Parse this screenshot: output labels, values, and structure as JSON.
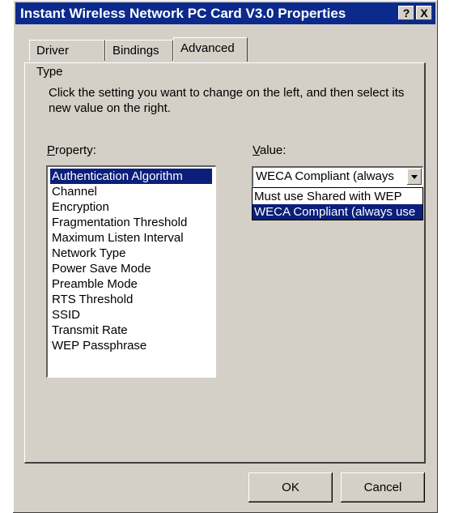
{
  "window": {
    "title": "Instant Wireless Network PC Card V3.0 Properties",
    "help_glyph": "?",
    "close_glyph": "X"
  },
  "tabs": [
    {
      "label": "Driver Type",
      "active": false
    },
    {
      "label": "Bindings",
      "active": false
    },
    {
      "label": "Advanced",
      "active": true
    }
  ],
  "advanced": {
    "instructions": "Click the setting you want to change on the left, and then select its new value on the right.",
    "property_label": {
      "accel": "P",
      "rest": "roperty:"
    },
    "value_label": {
      "accel": "V",
      "rest": "alue:"
    },
    "properties": [
      "Authentication Algorithm",
      "Channel",
      "Encryption",
      "Fragmentation Threshold",
      "Maximum Listen Interval",
      "Network Type",
      "Power Save Mode",
      "Preamble Mode",
      "RTS Threshold",
      "SSID",
      "Transmit Rate",
      "WEP Passphrase"
    ],
    "selected_property": "Authentication Algorithm",
    "value": {
      "current": "WECA Compliant (always",
      "options": [
        "Must use Shared with WEP",
        "WECA Compliant (always use"
      ],
      "highlighted_option": "WECA Compliant (always use"
    }
  },
  "buttons": {
    "ok": "OK",
    "cancel": "Cancel"
  },
  "colors": {
    "titlebar": "#0c2a8c",
    "selection": "#0b1f7a",
    "face": "#d4d0c8"
  }
}
